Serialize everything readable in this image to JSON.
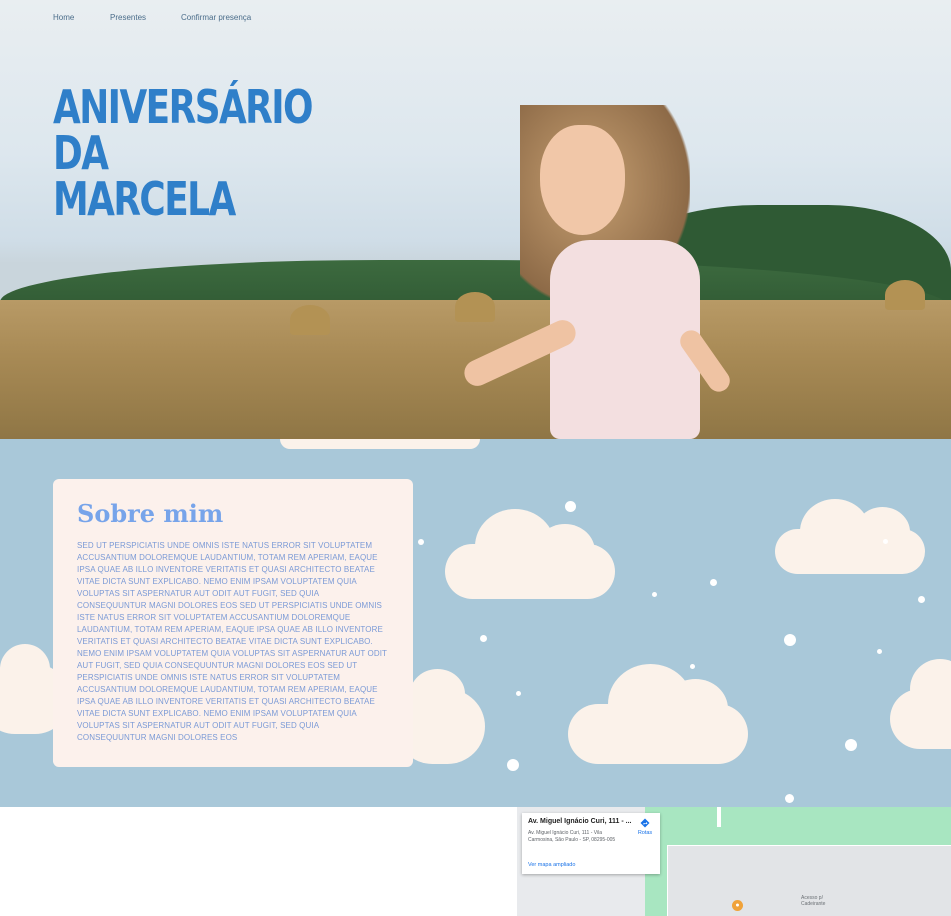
{
  "nav": {
    "items": [
      "Home",
      "Presentes",
      "Confirmar presença"
    ]
  },
  "hero": {
    "title": "ANIVERSÁRIO DA MARCELA"
  },
  "about": {
    "title": "Sobre mim",
    "text": "Sed ut perspiciatis unde omnis iste natus error sit voluptatem accusantium doloremque laudantium, totam rem aperiam, eaque ipsa quae ab illo inventore veritatis et quasi architecto beatae vitae dicta sunt explicabo. Nemo enim ipsam voluptatem quia voluptas sit aspernatur aut odit aut fugit, sed quia consequuntur magni dolores eos sed ut perspiciatis unde omnis iste natus error sit voluptatem accusantium doloremque laudantium, totam rem aperiam, eaque ipsa quae ab illo inventore veritatis et quasi architecto beatae vitae dicta sunt explicabo. Nemo enim ipsam voluptatem quia voluptas sit aspernatur aut odit aut fugit, sed quia consequuntur magni dolores eos sed ut perspiciatis unde omnis iste natus error sit voluptatem accusantium doloremque laudantium, totam rem aperiam, eaque ipsa quae ab illo inventore veritatis et quasi architecto beatae vitae dicta sunt explicabo. Nemo enim ipsam voluptatem quia voluptas sit aspernatur aut odit aut fugit, sed quia consequuntur magni dolores eos"
  },
  "map": {
    "title": "Av. Miguel Ignácio Curi, 111 - ...",
    "address": "Av. Miguel Ignácio Curi, 111 - Vila Carmosina, São Paulo - SP, 08295-005",
    "directions_label": "Rotas",
    "larger_map_label": "Ver mapa ampliado",
    "place_label": "Acesso p/ Cadeirante",
    "pin_icon": "map-pin-icon"
  },
  "colors": {
    "title_blue": "#2f7fc9",
    "sky_blue": "#a9c8d9",
    "card_bg": "#fcf1ec",
    "heading_blue": "#77a4ea"
  }
}
